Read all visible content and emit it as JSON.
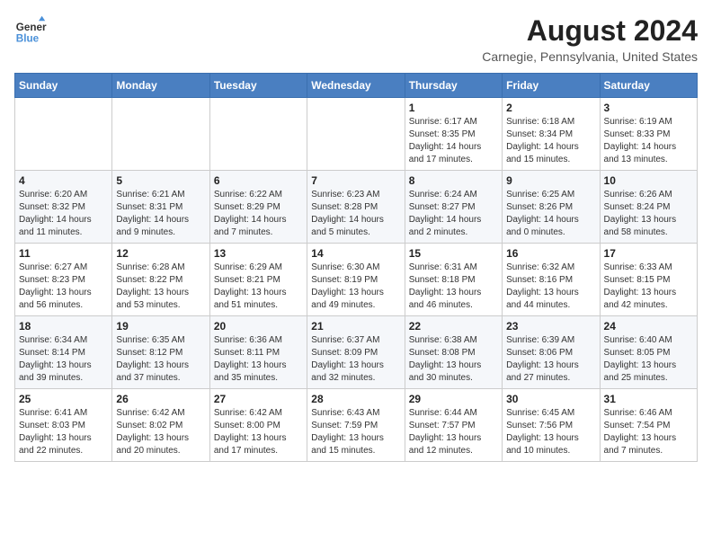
{
  "header": {
    "logo_line1": "General",
    "logo_line2": "Blue",
    "month_year": "August 2024",
    "location": "Carnegie, Pennsylvania, United States"
  },
  "weekdays": [
    "Sunday",
    "Monday",
    "Tuesday",
    "Wednesday",
    "Thursday",
    "Friday",
    "Saturday"
  ],
  "weeks": [
    [
      {
        "day": "",
        "info": ""
      },
      {
        "day": "",
        "info": ""
      },
      {
        "day": "",
        "info": ""
      },
      {
        "day": "",
        "info": ""
      },
      {
        "day": "1",
        "info": "Sunrise: 6:17 AM\nSunset: 8:35 PM\nDaylight: 14 hours\nand 17 minutes."
      },
      {
        "day": "2",
        "info": "Sunrise: 6:18 AM\nSunset: 8:34 PM\nDaylight: 14 hours\nand 15 minutes."
      },
      {
        "day": "3",
        "info": "Sunrise: 6:19 AM\nSunset: 8:33 PM\nDaylight: 14 hours\nand 13 minutes."
      }
    ],
    [
      {
        "day": "4",
        "info": "Sunrise: 6:20 AM\nSunset: 8:32 PM\nDaylight: 14 hours\nand 11 minutes."
      },
      {
        "day": "5",
        "info": "Sunrise: 6:21 AM\nSunset: 8:31 PM\nDaylight: 14 hours\nand 9 minutes."
      },
      {
        "day": "6",
        "info": "Sunrise: 6:22 AM\nSunset: 8:29 PM\nDaylight: 14 hours\nand 7 minutes."
      },
      {
        "day": "7",
        "info": "Sunrise: 6:23 AM\nSunset: 8:28 PM\nDaylight: 14 hours\nand 5 minutes."
      },
      {
        "day": "8",
        "info": "Sunrise: 6:24 AM\nSunset: 8:27 PM\nDaylight: 14 hours\nand 2 minutes."
      },
      {
        "day": "9",
        "info": "Sunrise: 6:25 AM\nSunset: 8:26 PM\nDaylight: 14 hours\nand 0 minutes."
      },
      {
        "day": "10",
        "info": "Sunrise: 6:26 AM\nSunset: 8:24 PM\nDaylight: 13 hours\nand 58 minutes."
      }
    ],
    [
      {
        "day": "11",
        "info": "Sunrise: 6:27 AM\nSunset: 8:23 PM\nDaylight: 13 hours\nand 56 minutes."
      },
      {
        "day": "12",
        "info": "Sunrise: 6:28 AM\nSunset: 8:22 PM\nDaylight: 13 hours\nand 53 minutes."
      },
      {
        "day": "13",
        "info": "Sunrise: 6:29 AM\nSunset: 8:21 PM\nDaylight: 13 hours\nand 51 minutes."
      },
      {
        "day": "14",
        "info": "Sunrise: 6:30 AM\nSunset: 8:19 PM\nDaylight: 13 hours\nand 49 minutes."
      },
      {
        "day": "15",
        "info": "Sunrise: 6:31 AM\nSunset: 8:18 PM\nDaylight: 13 hours\nand 46 minutes."
      },
      {
        "day": "16",
        "info": "Sunrise: 6:32 AM\nSunset: 8:16 PM\nDaylight: 13 hours\nand 44 minutes."
      },
      {
        "day": "17",
        "info": "Sunrise: 6:33 AM\nSunset: 8:15 PM\nDaylight: 13 hours\nand 42 minutes."
      }
    ],
    [
      {
        "day": "18",
        "info": "Sunrise: 6:34 AM\nSunset: 8:14 PM\nDaylight: 13 hours\nand 39 minutes."
      },
      {
        "day": "19",
        "info": "Sunrise: 6:35 AM\nSunset: 8:12 PM\nDaylight: 13 hours\nand 37 minutes."
      },
      {
        "day": "20",
        "info": "Sunrise: 6:36 AM\nSunset: 8:11 PM\nDaylight: 13 hours\nand 35 minutes."
      },
      {
        "day": "21",
        "info": "Sunrise: 6:37 AM\nSunset: 8:09 PM\nDaylight: 13 hours\nand 32 minutes."
      },
      {
        "day": "22",
        "info": "Sunrise: 6:38 AM\nSunset: 8:08 PM\nDaylight: 13 hours\nand 30 minutes."
      },
      {
        "day": "23",
        "info": "Sunrise: 6:39 AM\nSunset: 8:06 PM\nDaylight: 13 hours\nand 27 minutes."
      },
      {
        "day": "24",
        "info": "Sunrise: 6:40 AM\nSunset: 8:05 PM\nDaylight: 13 hours\nand 25 minutes."
      }
    ],
    [
      {
        "day": "25",
        "info": "Sunrise: 6:41 AM\nSunset: 8:03 PM\nDaylight: 13 hours\nand 22 minutes."
      },
      {
        "day": "26",
        "info": "Sunrise: 6:42 AM\nSunset: 8:02 PM\nDaylight: 13 hours\nand 20 minutes."
      },
      {
        "day": "27",
        "info": "Sunrise: 6:42 AM\nSunset: 8:00 PM\nDaylight: 13 hours\nand 17 minutes."
      },
      {
        "day": "28",
        "info": "Sunrise: 6:43 AM\nSunset: 7:59 PM\nDaylight: 13 hours\nand 15 minutes."
      },
      {
        "day": "29",
        "info": "Sunrise: 6:44 AM\nSunset: 7:57 PM\nDaylight: 13 hours\nand 12 minutes."
      },
      {
        "day": "30",
        "info": "Sunrise: 6:45 AM\nSunset: 7:56 PM\nDaylight: 13 hours\nand 10 minutes."
      },
      {
        "day": "31",
        "info": "Sunrise: 6:46 AM\nSunset: 7:54 PM\nDaylight: 13 hours\nand 7 minutes."
      }
    ]
  ]
}
